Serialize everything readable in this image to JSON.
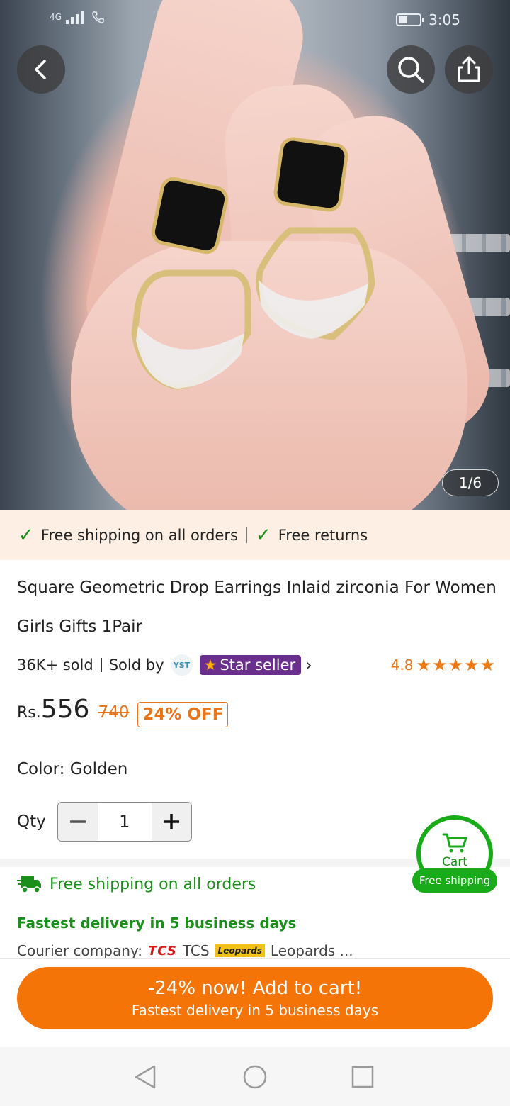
{
  "status_bar": {
    "network": "4G",
    "time": "3:05"
  },
  "gallery": {
    "counter": "1/6"
  },
  "shipping_banner": {
    "free_shipping": "Free shipping on all orders",
    "free_returns": "Free returns"
  },
  "product": {
    "title": "Square Geometric Drop Earrings Inlaid zirconia For Women Girls Gifts 1Pair",
    "sold": "36K+ sold",
    "sold_by_label": "Sold by",
    "seller_badge": "YST",
    "star_seller_label": "Star seller",
    "rating": "4.8",
    "price_currency": "Rs.",
    "price": "556",
    "old_price": "740",
    "discount": "24% OFF",
    "color_label": "Color:",
    "color_value": "Golden",
    "qty_label": "Qty",
    "qty_value": "1"
  },
  "delivery": {
    "title": "Free shipping on all orders",
    "fastest": "Fastest delivery in 5 business days",
    "courier_label": "Courier company:",
    "courier_1": "TCS",
    "courier_2": "Leopards ...",
    "tcs_logo_text": "TCS",
    "leopards_logo_text": "Leopards"
  },
  "floating_cart": {
    "label": "Cart",
    "pill": "Free shipping"
  },
  "cta": {
    "main": "-24% now! Add to cart!",
    "sub": "Fastest delivery in 5 business days"
  },
  "colors": {
    "accent_orange": "#f57408",
    "green": "#1a8f1a",
    "star_seller_purple": "#6a2e8c"
  }
}
